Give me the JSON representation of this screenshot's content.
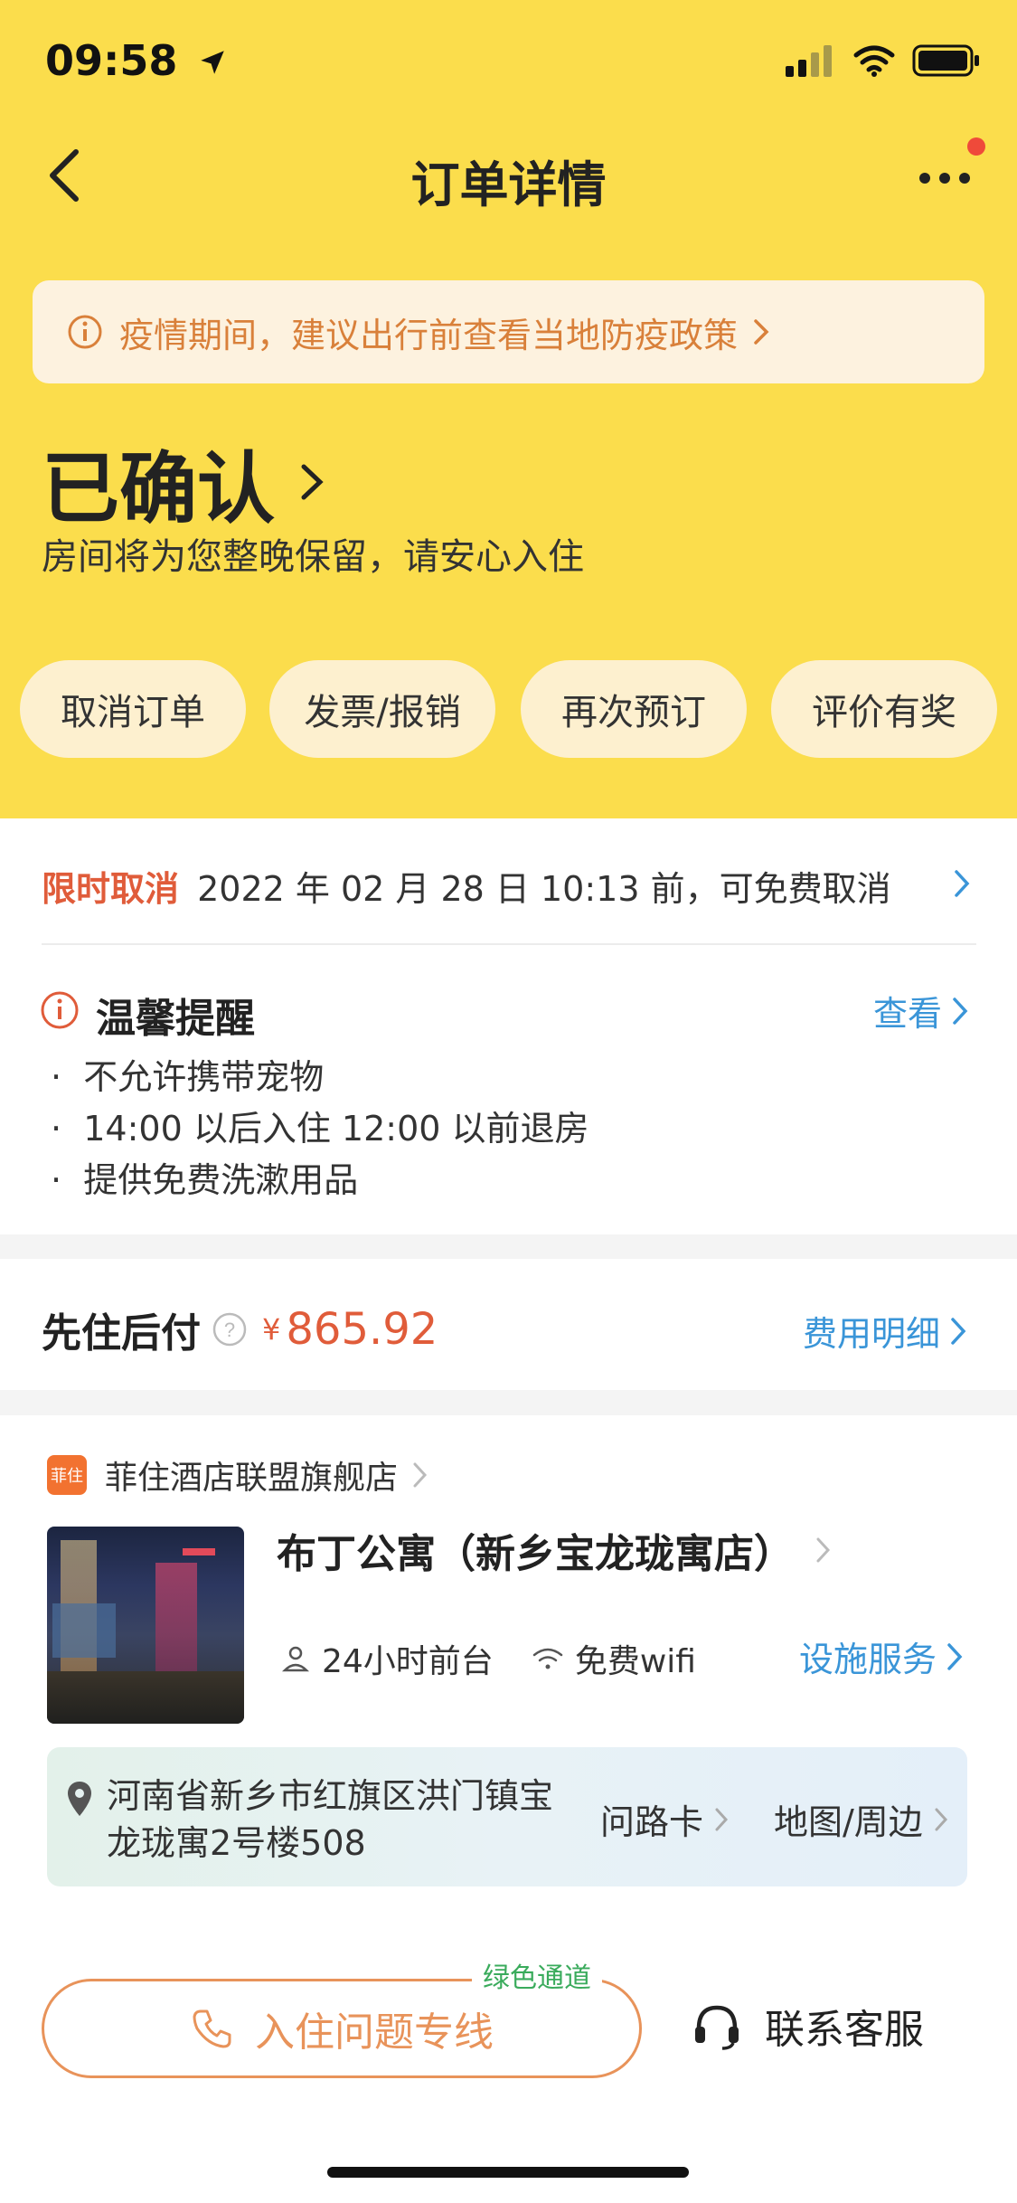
{
  "status_bar": {
    "time": "09:58"
  },
  "nav": {
    "title": "订单详情"
  },
  "notice": {
    "text": "疫情期间，建议出行前查看当地防疫政策"
  },
  "order_status": {
    "title": "已确认",
    "subtitle": "房间将为您整晚保留，请安心入住"
  },
  "actions": [
    {
      "label": "取消订单"
    },
    {
      "label": "发票/报销"
    },
    {
      "label": "再次预订"
    },
    {
      "label": "评价有奖"
    }
  ],
  "cancel_policy": {
    "tag": "限时取消",
    "text": "2022 年 02 月 28 日 10:13 前，可免费取消"
  },
  "reminder": {
    "title": "温馨提醒",
    "link": "查看",
    "items": [
      "不允许携带宠物",
      "14:00 以后入住 12:00 以前退房",
      "提供免费洗漱用品"
    ]
  },
  "payment": {
    "label": "先住后付",
    "currency": "¥",
    "amount": "865.92",
    "link": "费用明细"
  },
  "hotel": {
    "store_badge": "菲住",
    "store_name": "菲住酒店联盟旗舰店",
    "name": "布丁公寓（新乡宝龙珑寓店）",
    "feature_1": "24小时前台",
    "feature_2": "免费wifi",
    "services_link": "设施服务",
    "address": "河南省新乡市红旗区洪门镇宝龙珑寓2号楼508",
    "route_card": "问路卡",
    "map_link": "地图/周边"
  },
  "bottom": {
    "green_tag": "绿色通道",
    "hotline": "入住问题专线",
    "customer_service": "联系客服"
  },
  "colors": {
    "yellow": "#fbdd4c",
    "accent_red": "#e05c3a",
    "link_blue": "#3a95d8",
    "green": "#3aab5c"
  }
}
